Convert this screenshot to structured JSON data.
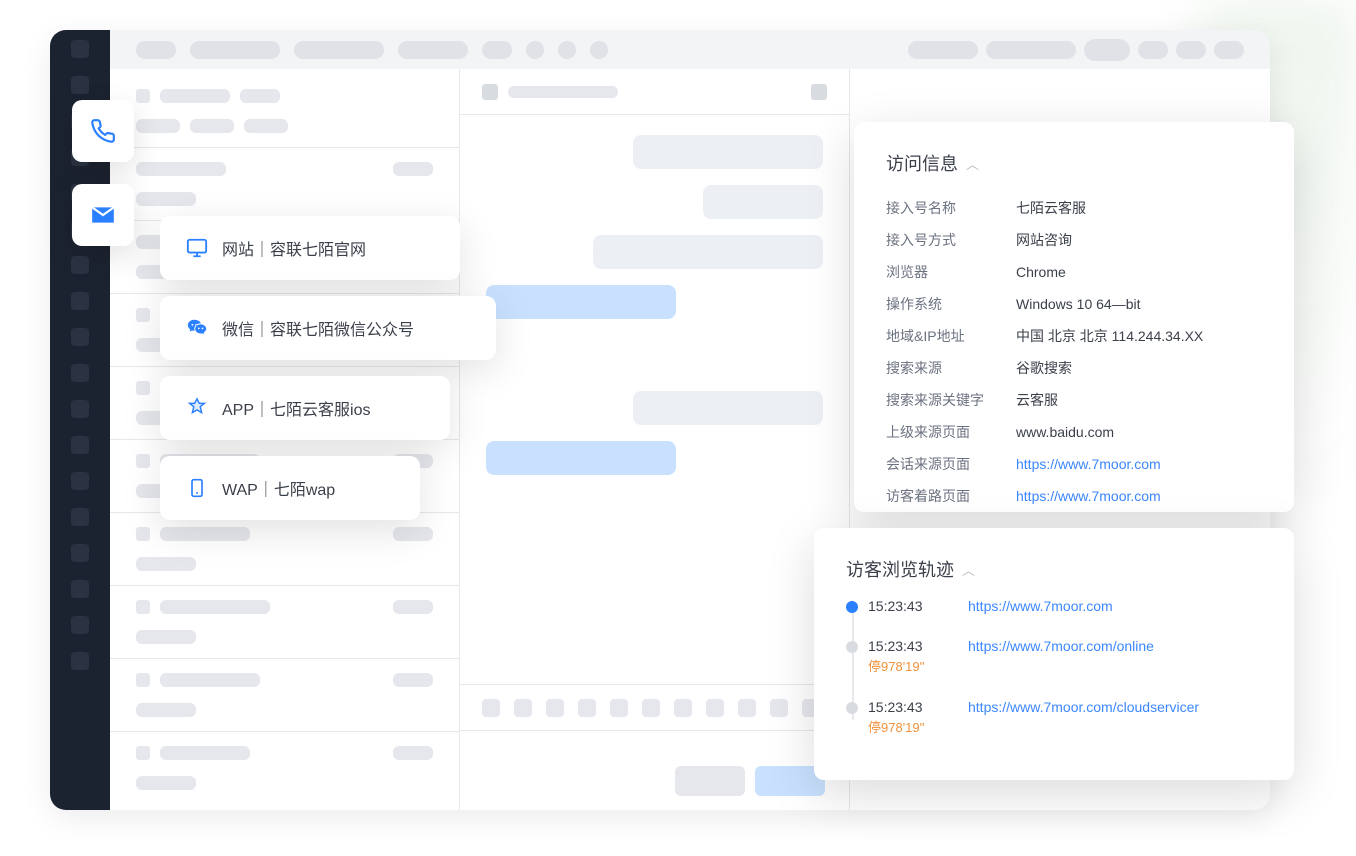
{
  "channels": [
    {
      "icon": "monitor-icon",
      "label": "网站｜容联七陌官网"
    },
    {
      "icon": "wechat-icon",
      "label": "微信｜容联七陌微信公众号"
    },
    {
      "icon": "app-icon",
      "label": "APP｜七陌云客服ios"
    },
    {
      "icon": "phone-wap-icon",
      "label": "WAP｜七陌wap"
    }
  ],
  "visit_info": {
    "title": "访问信息",
    "rows": [
      {
        "k": "接入号名称",
        "v": "七陌云客服"
      },
      {
        "k": "接入号方式",
        "v": "网站咨询"
      },
      {
        "k": "浏览器",
        "v": "Chrome"
      },
      {
        "k": "操作系统",
        "v": "Windows 10 64—bit"
      },
      {
        "k": "地域&IP地址",
        "v": "中国 北京 北京 114.244.34.XX"
      },
      {
        "k": "搜索来源",
        "v": "谷歌搜索"
      },
      {
        "k": "搜索来源关键字",
        "v": "云客服"
      },
      {
        "k": "上级来源页面",
        "v": "www.baidu.com"
      },
      {
        "k": "会话来源页面",
        "v": "https://www.7moor.com",
        "link": true
      },
      {
        "k": "访客着路页面",
        "v": "https://www.7moor.com",
        "link": true
      }
    ]
  },
  "trail": {
    "title": "访客浏览轨迹",
    "items": [
      {
        "time": "15:23:43",
        "url": "https://www.7moor.com",
        "duration": ""
      },
      {
        "time": "15:23:43",
        "url": "https://www.7moor.com/online",
        "duration": "停978'19''"
      },
      {
        "time": "15:23:43",
        "url": "https://www.7moor.com/cloudservicer",
        "duration": "停978'19''"
      }
    ]
  }
}
